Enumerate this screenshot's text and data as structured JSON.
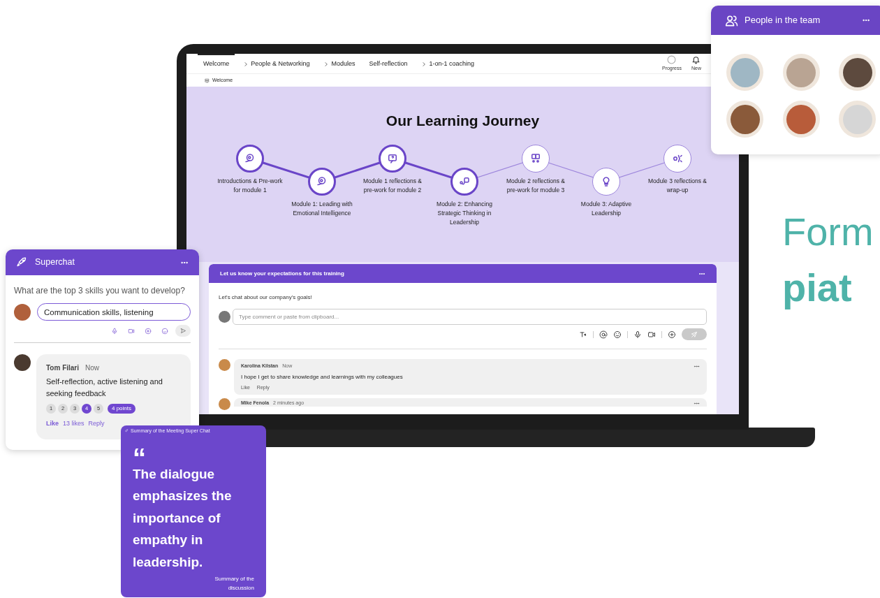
{
  "laptop_screen": {
    "nav_tabs": [
      {
        "label": "Welcome",
        "chevron": false,
        "selected": true
      },
      {
        "label": "People & Networking",
        "chevron": true,
        "selected": false
      },
      {
        "label": "Modules",
        "chevron": true,
        "selected": false
      },
      {
        "label": "Self-reflection",
        "chevron": false,
        "selected": false
      },
      {
        "label": "1-on-1 coaching",
        "chevron": true,
        "selected": false
      }
    ],
    "progress_label": "Progress",
    "new_label": "New",
    "breadcrumb": "Welcome",
    "hero_title": "Our Learning Journey",
    "journey": [
      {
        "label": "Introductions & Pre-work for module 1",
        "done": true
      },
      {
        "label": "Module 1: Leading with Emotional Intelligence",
        "done": true
      },
      {
        "label": "Module 1 reflections & pre-work for module 2",
        "done": true
      },
      {
        "label": "Module 2: Enhancing Strategic Thinking in Leadership",
        "done": true
      },
      {
        "label": "Module 2 reflections & pre-work for module 3",
        "done": false
      },
      {
        "label": "Module 3: Adaptive Leadership",
        "done": false
      },
      {
        "label": "Module 3 reflections & wrap-up",
        "done": false
      }
    ],
    "chat_card": {
      "title": "Let us know your expectations for this training",
      "intro": "Let's chat about our company's goals!",
      "comment_placeholder": "Type comment or paste from clipboard...",
      "comments": [
        {
          "author": "Karolina Kilstan",
          "time": "Now",
          "text": "I hope I get to share knowledge and learnings with my colleagues",
          "actions": [
            "Like",
            "Reply"
          ]
        },
        {
          "author": "Mike Fenola",
          "time": "2 minutes ago"
        }
      ]
    }
  },
  "superchat": {
    "title": "Superchat",
    "question": "What are the top 3 skills you want to develop?",
    "answer_value": "Communication skills, listening",
    "reply": {
      "author": "Tom Filari",
      "time": "Now",
      "text": "Self-reflection, active listening and seeking feedback",
      "ratings": [
        {
          "label": "1",
          "selected": false
        },
        {
          "label": "2",
          "selected": false
        },
        {
          "label": "3",
          "selected": false
        },
        {
          "label": "4",
          "selected": true
        },
        {
          "label": "5",
          "selected": false
        }
      ],
      "points": "4 points",
      "like": "Like",
      "likes": "13 likes",
      "reply": "Reply"
    }
  },
  "summary_card": {
    "header": "Summary of the Meeting Super Chat",
    "quote_mark": "“",
    "quote": "The dialogue emphasizes the importance of empathy in leadership.",
    "caption": "Summary of the discussion"
  },
  "team_card": {
    "title": "People in the team",
    "members": [
      {
        "kind": "photo"
      },
      {
        "kind": "photo"
      },
      {
        "kind": "photo"
      },
      {
        "kind": "photo"
      },
      {
        "kind": "photo"
      },
      {
        "kind": "photo"
      }
    ]
  },
  "headline": {
    "line_1": "Form",
    "line_2": "piat"
  }
}
